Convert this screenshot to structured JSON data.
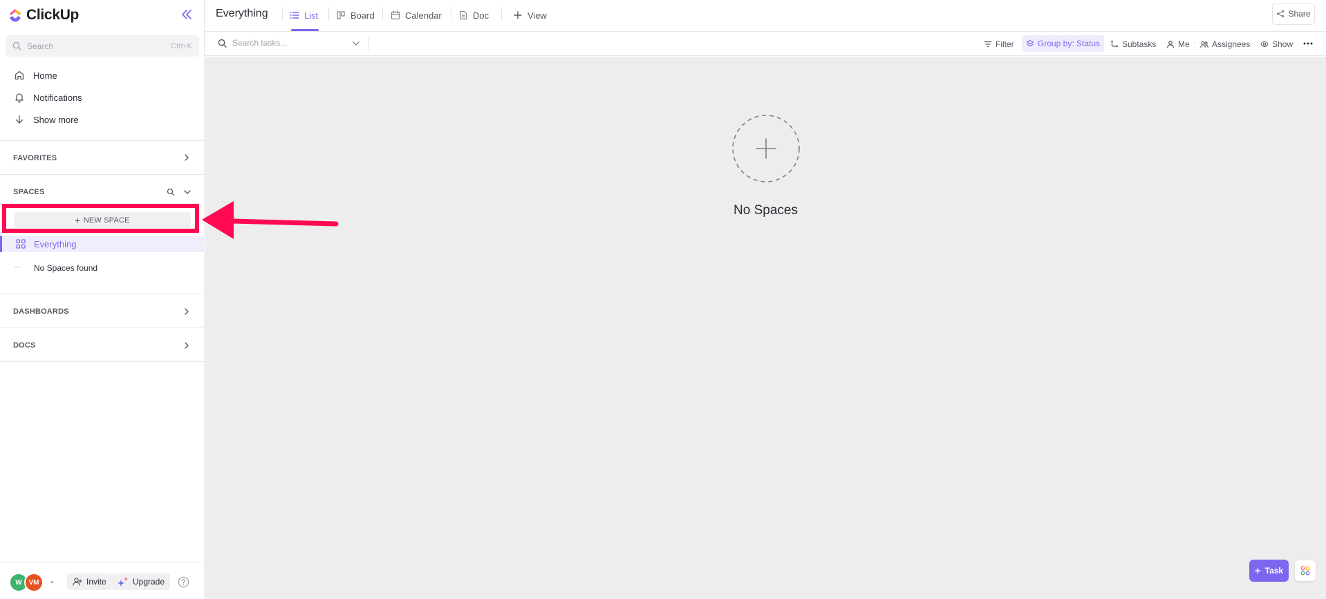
{
  "app": {
    "name": "ClickUp"
  },
  "sidebar": {
    "search": {
      "placeholder": "Search",
      "shortcut": "Ctrl+K"
    },
    "nav": [
      {
        "label": "Home",
        "icon": "home-icon"
      },
      {
        "label": "Notifications",
        "icon": "bell-icon"
      },
      {
        "label": "Show more",
        "icon": "arrow-down-icon"
      }
    ],
    "sections": {
      "favorites": "FAVORITES",
      "spaces": "SPACES",
      "dashboards": "DASHBOARDS",
      "docs": "DOCS"
    },
    "new_space_label": "NEW SPACE",
    "everything_label": "Everything",
    "no_spaces_label": "No Spaces found",
    "footer": {
      "avatars": [
        {
          "initials": "W",
          "color": "#3db46d"
        },
        {
          "initials": "VM",
          "color": "#e8501e"
        }
      ],
      "invite_label": "Invite",
      "upgrade_label": "Upgrade"
    }
  },
  "header": {
    "title": "Everything",
    "tabs": [
      {
        "label": "List",
        "icon": "list-icon",
        "active": true
      },
      {
        "label": "Board",
        "icon": "board-icon",
        "active": false
      },
      {
        "label": "Calendar",
        "icon": "calendar-icon",
        "active": false
      },
      {
        "label": "Doc",
        "icon": "doc-icon",
        "active": false
      }
    ],
    "add_view_label": "View",
    "share_label": "Share"
  },
  "toolbar": {
    "search_placeholder": "Search tasks...",
    "filter_label": "Filter",
    "group_label": "Group by: Status",
    "subtasks_label": "Subtasks",
    "me_label": "Me",
    "assignees_label": "Assignees",
    "show_label": "Show"
  },
  "main": {
    "empty_title": "No Spaces",
    "task_button_label": "Task"
  },
  "colors": {
    "accent": "#7b68ee",
    "annotation": "#ff0a52",
    "canvas": "#ededed"
  }
}
